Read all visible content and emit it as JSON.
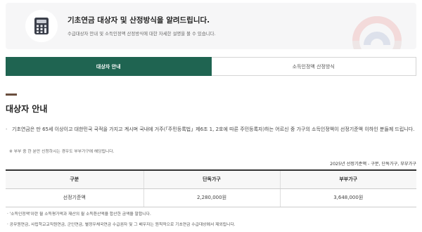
{
  "banner": {
    "title": "기초연금 대상자 및 산정방식을 알려드립니다.",
    "description": "수급대상자 안내 및 소득인정액 산정방식에 대한 자세한 설명을 볼 수 있습니다.",
    "icon": "calculator-icon",
    "emblem": "government-emblem",
    "accent": "#1f6451"
  },
  "tabs": [
    {
      "label": "대상자 안내",
      "active": true
    },
    {
      "label": "소득인정액 산정방식",
      "active": false
    }
  ],
  "section": {
    "title": "대상자 안내",
    "paragraph_marker": "·",
    "paragraph": "기초연금은 만 65세 이상이고 대한민국 국적을 가지고 계시며 국내에 거주(「주민등록법」제6조 1, 2호에 따른 주민등록자)하는 어르신 중 가구의 소득인정액이 선정기준액 이하인 분들께 드립니다.",
    "note": "※ 부부 중 한 분만 신청하시는 경우도 부부가구에 해당됩니다."
  },
  "table": {
    "caption": "2025년 선정기준액 - 구분, 단독가구, 부부가구",
    "headers": [
      "구분",
      "단독가구",
      "부부가구"
    ],
    "rows": [
      [
        "선정기준액",
        "2,280,000원",
        "3,648,000원"
      ]
    ]
  },
  "footnotes": [
    "· '소득인정액'이란 월 소득평가액과 재산의 월 소득환산액을 합산한 금액을 말합니다.",
    "· 공무원연금, 사립학교교직원연금, 군인연금, 별정우체국연금 수급권자 및 그 배우자는 원칙적으로 기초연금 수급대상에서 제외됩니다."
  ]
}
